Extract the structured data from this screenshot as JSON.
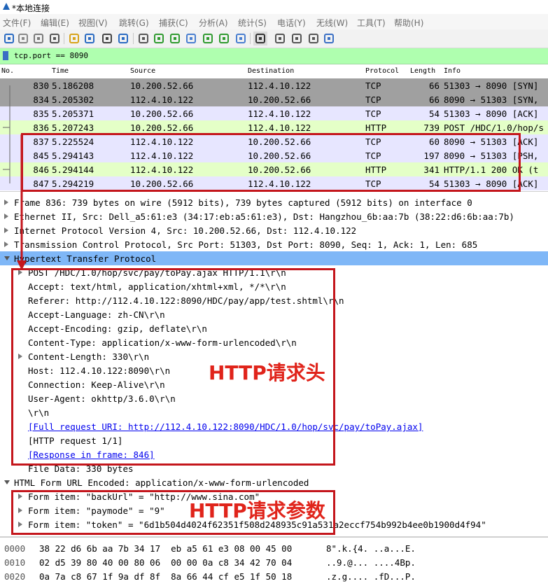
{
  "window": {
    "title": "*本地连接"
  },
  "menu": [
    "文件(F)",
    "编辑(E)",
    "视图(V)",
    "跳转(G)",
    "捕获(C)",
    "分析(A)",
    "统计(S)",
    "电话(Y)",
    "无线(W)",
    "工具(T)",
    "帮助(H)"
  ],
  "toolbar_icons": [
    "shark-fin-start-icon",
    "stop-icon",
    "restart-icon",
    "options-gear-icon",
    "open-file-icon",
    "save-file-icon",
    "close-file-icon",
    "reload-icon",
    "find-icon",
    "back-arrow-icon",
    "forward-arrow-icon",
    "go-to-packet-icon",
    "first-packet-icon",
    "last-packet-icon",
    "autoscroll-icon",
    "colorize-icon",
    "zoom-in-icon",
    "zoom-out-icon",
    "zoom-reset-icon",
    "resize-columns-icon"
  ],
  "filter": {
    "text": "tcp.port == 8090"
  },
  "packet_list": {
    "columns": [
      "No.",
      "Time",
      "Source",
      "Destination",
      "Protocol",
      "Length",
      "Info"
    ],
    "rows": [
      {
        "no": "830",
        "time": "5.186208",
        "src": "10.200.52.66",
        "dst": "112.4.10.122",
        "proto": "TCP",
        "len": "66",
        "info": "51303 → 8090 [SYN]",
        "bg": "#a0a0a0"
      },
      {
        "no": "834",
        "time": "5.205302",
        "src": "112.4.10.122",
        "dst": "10.200.52.66",
        "proto": "TCP",
        "len": "66",
        "info": "8090 → 51303 [SYN,",
        "bg": "#a0a0a0"
      },
      {
        "no": "835",
        "time": "5.205371",
        "src": "10.200.52.66",
        "dst": "112.4.10.122",
        "proto": "TCP",
        "len": "54",
        "info": "51303 → 8090 [ACK]",
        "bg": "#e7e6ff"
      },
      {
        "no": "836",
        "time": "5.207243",
        "src": "10.200.52.66",
        "dst": "112.4.10.122",
        "proto": "HTTP",
        "len": "739",
        "info": "POST /HDC/1.0/hop/s",
        "bg": "#e4ffc7"
      },
      {
        "no": "837",
        "time": "5.225524",
        "src": "112.4.10.122",
        "dst": "10.200.52.66",
        "proto": "TCP",
        "len": "60",
        "info": "8090 → 51303 [ACK]",
        "bg": "#e7e6ff"
      },
      {
        "no": "845",
        "time": "5.294143",
        "src": "112.4.10.122",
        "dst": "10.200.52.66",
        "proto": "TCP",
        "len": "197",
        "info": "8090 → 51303 [PSH,",
        "bg": "#e7e6ff"
      },
      {
        "no": "846",
        "time": "5.294144",
        "src": "112.4.10.122",
        "dst": "10.200.52.66",
        "proto": "HTTP",
        "len": "341",
        "info": "HTTP/1.1 200 OK  (t",
        "bg": "#e4ffc7"
      },
      {
        "no": "847",
        "time": "5.294219",
        "src": "10.200.52.66",
        "dst": "112.4.10.122",
        "proto": "TCP",
        "len": "54",
        "info": "51303 → 8090 [ACK]",
        "bg": "#e7e6ff"
      }
    ]
  },
  "detail": [
    {
      "text": "Frame 836: 739 bytes on wire (5912 bits), 739 bytes captured (5912 bits) on interface 0",
      "indent": 0,
      "tri": "closed"
    },
    {
      "text": "Ethernet II, Src: Dell_a5:61:e3 (34:17:eb:a5:61:e3), Dst: Hangzhou_6b:aa:7b (38:22:d6:6b:aa:7b)",
      "indent": 0,
      "tri": "closed"
    },
    {
      "text": "Internet Protocol Version 4, Src: 10.200.52.66, Dst: 112.4.10.122",
      "indent": 0,
      "tri": "closed"
    },
    {
      "text": "Transmission Control Protocol, Src Port: 51303, Dst Port: 8090, Seq: 1, Ack: 1, Len: 685",
      "indent": 0,
      "tri": "closed"
    },
    {
      "text": "Hypertext Transfer Protocol",
      "indent": 0,
      "tri": "open",
      "selected": true
    },
    {
      "text": "POST /HDC/1.0/hop/svc/pay/toPay.ajax HTTP/1.1\\r\\n",
      "indent": 1,
      "tri": "closed"
    },
    {
      "text": "Accept: text/html, application/xhtml+xml, */*\\r\\n",
      "indent": 1,
      "tri": "none"
    },
    {
      "text": "Referer: http://112.4.10.122:8090/HDC/pay/app/test.shtml\\r\\n",
      "indent": 1,
      "tri": "none"
    },
    {
      "text": "Accept-Language: zh-CN\\r\\n",
      "indent": 1,
      "tri": "none"
    },
    {
      "text": "Accept-Encoding: gzip, deflate\\r\\n",
      "indent": 1,
      "tri": "none"
    },
    {
      "text": "Content-Type: application/x-www-form-urlencoded\\r\\n",
      "indent": 1,
      "tri": "none"
    },
    {
      "text": "Content-Length: 330\\r\\n",
      "indent": 1,
      "tri": "closed"
    },
    {
      "text": "Host: 112.4.10.122:8090\\r\\n",
      "indent": 1,
      "tri": "none"
    },
    {
      "text": "Connection: Keep-Alive\\r\\n",
      "indent": 1,
      "tri": "none"
    },
    {
      "text": "User-Agent: okhttp/3.6.0\\r\\n",
      "indent": 1,
      "tri": "none"
    },
    {
      "text": "\\r\\n",
      "indent": 1,
      "tri": "none"
    },
    {
      "text": "[Full request URI: http://112.4.10.122:8090/HDC/1.0/hop/svc/pay/toPay.ajax]",
      "indent": 1,
      "tri": "none",
      "link": true
    },
    {
      "text": "[HTTP request 1/1]",
      "indent": 1,
      "tri": "none"
    },
    {
      "text": "[Response in frame: 846]",
      "indent": 1,
      "tri": "none",
      "link": true
    },
    {
      "text": "File Data: 330 bytes",
      "indent": 1,
      "tri": "none"
    },
    {
      "text": "HTML Form URL Encoded: application/x-www-form-urlencoded",
      "indent": 0,
      "tri": "open"
    },
    {
      "text": "Form item: \"backUrl\" = \"http://www.sina.com\"",
      "indent": 1,
      "tri": "closed"
    },
    {
      "text": "Form item: \"paymode\" = \"9\"",
      "indent": 1,
      "tri": "closed"
    },
    {
      "text": "Form item: \"token\" = \"6d1b504d4024f62351f508d248935c91a531a2eccf754b992b4ee0b1900d4f94\"",
      "indent": 1,
      "tri": "closed"
    }
  ],
  "hex": [
    {
      "offset": "0000",
      "bytes": "38 22 d6 6b aa 7b 34 17  eb a5 61 e3 08 00 45 00",
      "ascii": "8\".k.{4. ..a...E."
    },
    {
      "offset": "0010",
      "bytes": "02 d5 39 80 40 00 80 06  00 00 0a c8 34 42 70 04",
      "ascii": "..9.@... ....4Bp."
    },
    {
      "offset": "0020",
      "bytes": "0a 7a c8 67 1f 9a df 8f  8a 66 44 cf e5 1f 50 18",
      "ascii": ".z.g.... .fD...P."
    }
  ],
  "annotations": {
    "headers_label": "HTTP请求头",
    "params_label": "HTTP请求参数"
  },
  "colors": {
    "selected": "#7fb7f7",
    "http_row": "#e4ffc7",
    "tcp_row": "#e7e6ff",
    "syn_row": "#a0a0a0",
    "filter_ok": "#afffaf",
    "annotation": "#c4161c"
  }
}
